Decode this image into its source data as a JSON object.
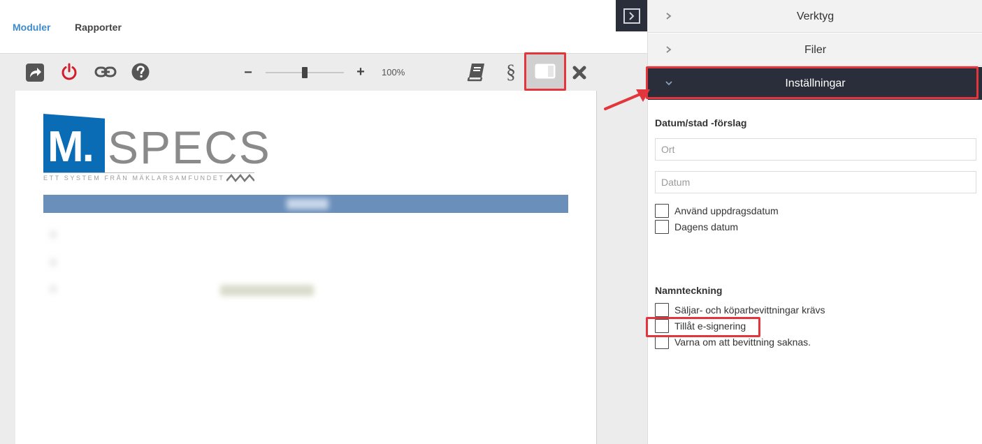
{
  "nav": {
    "tabs": [
      {
        "label": "Moduler",
        "active": true
      },
      {
        "label": "Rapporter",
        "active": false
      }
    ]
  },
  "toolbar": {
    "zoom_level": "100%",
    "zoom_minus": "−",
    "zoom_plus": "+",
    "section_symbol": "§",
    "icons": [
      "share-icon",
      "power-icon",
      "link-icon",
      "help-icon",
      "zoom-out-icon",
      "zoom-slider",
      "zoom-in-icon",
      "book-icon",
      "section-icon",
      "panel-toggle-icon",
      "close-icon"
    ]
  },
  "document": {
    "logo": {
      "letter": "M.",
      "word": "SPECS",
      "tagline": "ETT SYSTEM FRÅN MÄKLARSAMFUNDET"
    }
  },
  "panel": {
    "accordion": [
      {
        "label": "Verktyg",
        "expanded": false
      },
      {
        "label": "Filer",
        "expanded": false
      },
      {
        "label": "Inställningar",
        "expanded": true
      }
    ],
    "datum_section": {
      "title": "Datum/stad -förslag",
      "ort_placeholder": "Ort",
      "datum_placeholder": "Datum",
      "checkboxes": [
        {
          "label": "Använd uppdragsdatum",
          "checked": false
        },
        {
          "label": "Dagens datum",
          "checked": false
        }
      ]
    },
    "namn_section": {
      "title": "Namnteckning",
      "checkboxes": [
        {
          "label": "Säljar- och köparbevittningar krävs",
          "checked": false
        },
        {
          "label": "Tillåt e-signering",
          "checked": false
        },
        {
          "label": "Varna om att bevittning saknas.",
          "checked": false
        }
      ]
    }
  },
  "colors": {
    "accent_blue": "#3d8bcd",
    "active_header": "#2a2e3b",
    "annotation_red": "#e2363c",
    "logo_blue": "#0a6cb5",
    "power_red": "#d0202e"
  }
}
